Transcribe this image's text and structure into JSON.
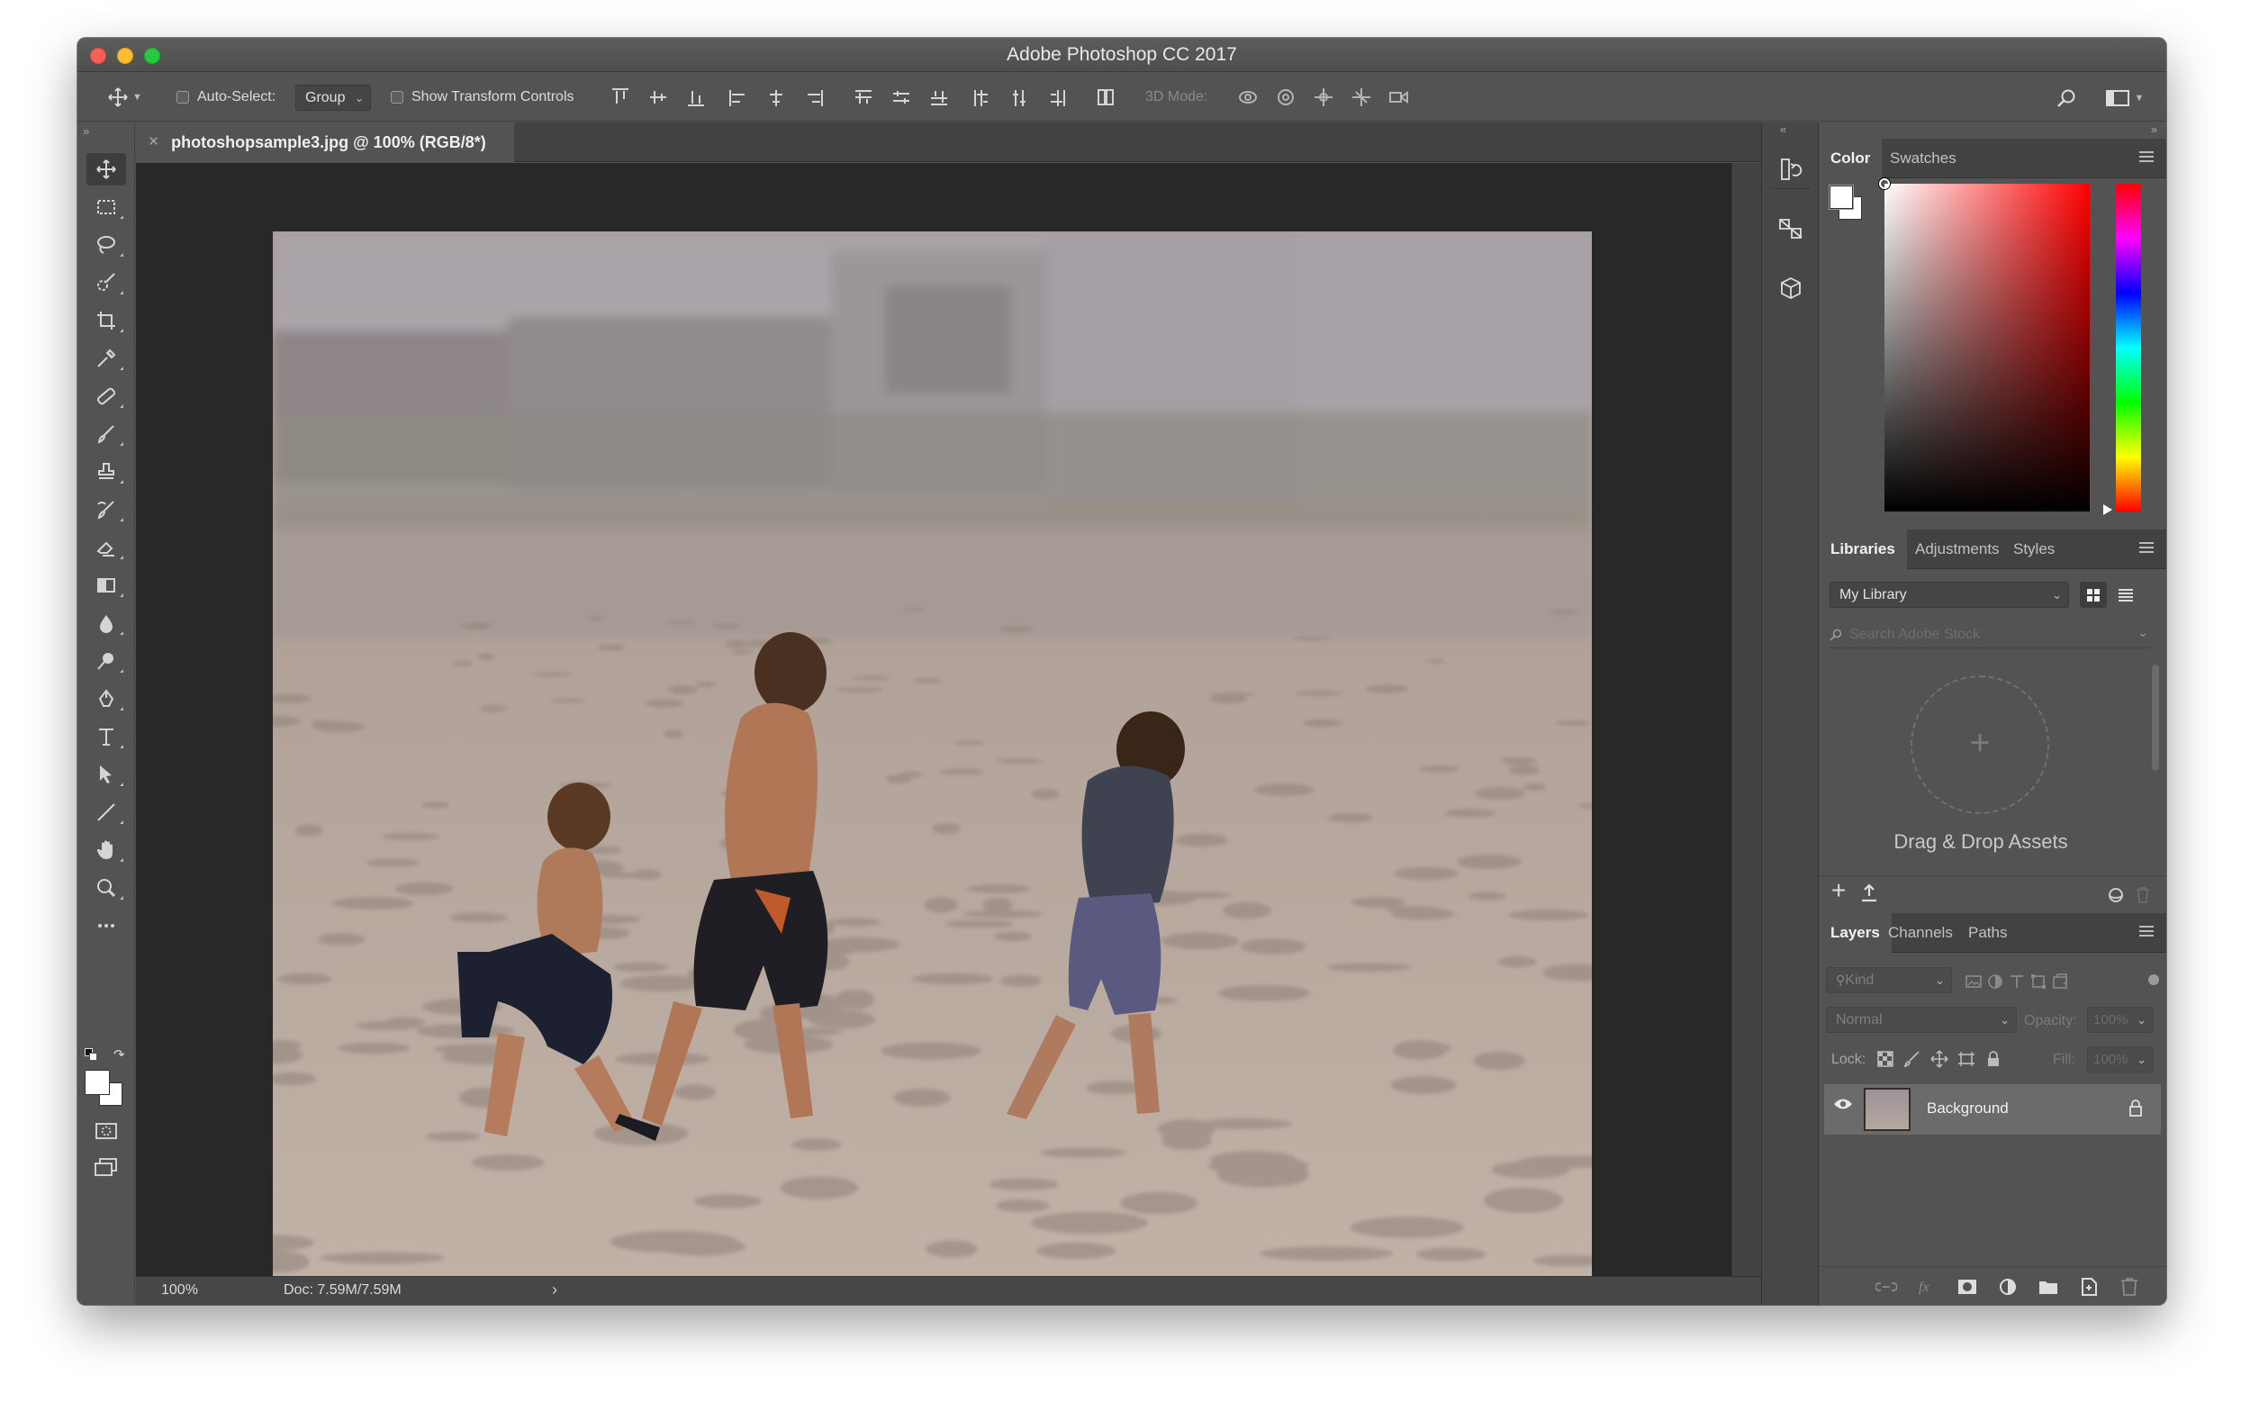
{
  "window": {
    "title": "Adobe Photoshop CC 2017"
  },
  "options_bar": {
    "auto_select_label": "Auto-Select:",
    "auto_select_value": "Group",
    "show_transform_label": "Show Transform Controls",
    "mode_3d_label": "3D Mode:"
  },
  "document": {
    "tab_title": "photoshopsample3.jpg @ 100% (RGB/8*)",
    "zoom": "100%",
    "doc_size": "Doc: 7.59M/7.59M"
  },
  "panels": {
    "color_tabs": [
      "Color",
      "Swatches"
    ],
    "libraries_tabs": [
      "Libraries",
      "Adjustments",
      "Styles"
    ],
    "library_select": "My Library",
    "search_placeholder": "Search Adobe Stock",
    "drop_text": "Drag & Drop Assets",
    "layers_tabs": [
      "Layers",
      "Channels",
      "Paths"
    ],
    "kind_filter": "Kind",
    "blend_mode": "Normal",
    "opacity_label": "Opacity:",
    "opacity_value": "100%",
    "lock_label": "Lock:",
    "fill_label": "Fill:",
    "fill_value": "100%",
    "layers": [
      {
        "name": "Background",
        "visible": true,
        "locked": true
      }
    ]
  },
  "tools": [
    "move-icon",
    "marquee-icon",
    "lasso-icon",
    "quick-select-icon",
    "crop-icon",
    "eyedropper-icon",
    "healing-icon",
    "brush-icon",
    "stamp-icon",
    "history-brush-icon",
    "eraser-icon",
    "gradient-icon",
    "blur-icon",
    "dodge-icon",
    "pen-icon",
    "type-icon",
    "path-select-icon",
    "line-icon",
    "hand-icon",
    "zoom-icon",
    "more-tools-icon"
  ],
  "colors": {
    "foreground": "#ffffff",
    "background": "#ffffff",
    "picker_hue": "#ff0000"
  }
}
